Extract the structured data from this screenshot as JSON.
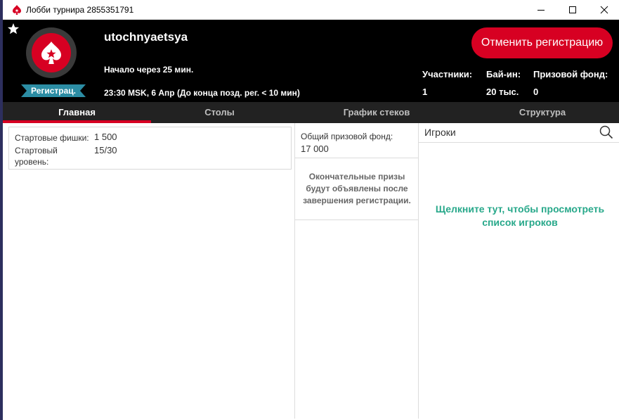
{
  "window": {
    "title": "Лобби турнира 2855351791",
    "icon": "pokerstars-spade-icon",
    "controls": [
      "minimize-icon",
      "maximize-icon",
      "close-icon"
    ]
  },
  "header": {
    "tournament_name": "utochnyaetsya",
    "starts_in": "Начало через 25 мин.",
    "date_line": "23:30 MSK, 6 Апр (До конца позд. рег. < 10 мин)",
    "status_badge": "Регистрац.",
    "unregister_label": "Отменить регистрацию",
    "stats": {
      "players_label": "Участники:",
      "players_value": "1",
      "buyin_label": "Бай-ин:",
      "buyin_value": "20 тыс.",
      "prize_label": "Призовой фонд:",
      "prize_value": "0"
    }
  },
  "tabs": [
    {
      "label": "Главная",
      "active": true
    },
    {
      "label": "Столы",
      "active": false
    },
    {
      "label": "График стеков",
      "active": false
    },
    {
      "label": "Структура",
      "active": false
    }
  ],
  "info": {
    "starting_chips_label": "Стартовые фишки:",
    "starting_chips_value": "1 500",
    "starting_level_label_1": "Стартовый",
    "starting_level_label_2": "уровень:",
    "starting_level_value": "15/30"
  },
  "prize": {
    "total_label": "Общий призовой фонд:",
    "total_value": "17 000",
    "final_note": "Окончательные призы будут объявлены после завершения регистрации."
  },
  "players": {
    "title": "Игроки",
    "link_text": "Щелкните тут, чтобы просмотреть список игроков"
  },
  "colors": {
    "brand_red": "#d70022",
    "badge_teal": "#2c8da4",
    "link_green": "#27a88a",
    "header_bg": "#000000",
    "tabs_bg": "#222222"
  }
}
